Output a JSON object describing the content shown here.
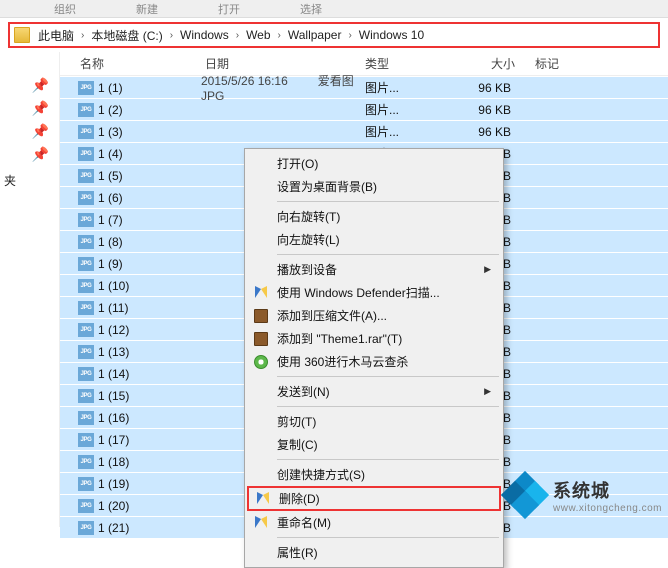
{
  "toolbar": {
    "a": "组织",
    "b": "新建",
    "c": "打开",
    "d": "选择"
  },
  "breadcrumbs": [
    "此电脑",
    "本地磁盘 (C:)",
    "Windows",
    "Web",
    "Wallpaper",
    "Windows 10"
  ],
  "nav": {
    "folders_label": "夹"
  },
  "columns": {
    "name": "名称",
    "date": "日期",
    "type": "类型",
    "size": "大小",
    "tag": "标记"
  },
  "row_preview": {
    "date": "2015/5/26 16:16",
    "app": "爱看图 JPG"
  },
  "type_label": "图片...",
  "size_label": "96 KB",
  "files": [
    {
      "n": "1 (1)"
    },
    {
      "n": "1 (2)"
    },
    {
      "n": "1 (3)"
    },
    {
      "n": "1 (4)"
    },
    {
      "n": "1 (5)"
    },
    {
      "n": "1 (6)"
    },
    {
      "n": "1 (7)"
    },
    {
      "n": "1 (8)"
    },
    {
      "n": "1 (9)"
    },
    {
      "n": "1 (10)"
    },
    {
      "n": "1 (11)"
    },
    {
      "n": "1 (12)"
    },
    {
      "n": "1 (13)"
    },
    {
      "n": "1 (14)"
    },
    {
      "n": "1 (15)"
    },
    {
      "n": "1 (16)"
    },
    {
      "n": "1 (17)"
    },
    {
      "n": "1 (18)"
    },
    {
      "n": "1 (19)"
    },
    {
      "n": "1 (20)"
    },
    {
      "n": "1 (21)"
    }
  ],
  "context_menu": {
    "open": "打开(O)",
    "set_wallpaper": "设置为桌面背景(B)",
    "rotate_right": "向右旋转(T)",
    "rotate_left": "向左旋转(L)",
    "play_to": "播放到设备",
    "defender": "使用 Windows Defender扫描...",
    "add_rar": "添加到压缩文件(A)...",
    "add_theme": "添加到 \"Theme1.rar\"(T)",
    "scan_360": "使用 360进行木马云查杀",
    "send_to": "发送到(N)",
    "cut": "剪切(T)",
    "copy": "复制(C)",
    "shortcut": "创建快捷方式(S)",
    "delete": "删除(D)",
    "rename": "重命名(M)",
    "properties": "属性(R)"
  },
  "watermark": {
    "title": "系统城",
    "url": "www.xitongcheng.com"
  }
}
